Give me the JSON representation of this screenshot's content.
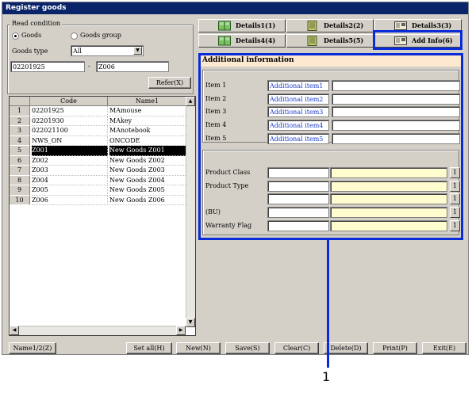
{
  "window": {
    "title": "Register goods"
  },
  "read_condition": {
    "title": "Read condition",
    "radio_goods": "Goods",
    "radio_goods_group": "Goods group",
    "goods_type_label": "Goods type",
    "goods_type_value": "All",
    "range_from": "02201925",
    "range_sep": "-",
    "range_to": "Z006",
    "refer_button": "Refer(X)"
  },
  "grid": {
    "headers": [
      "Code",
      "Name1"
    ],
    "rows": [
      {
        "n": "1",
        "code": "02201925",
        "name": "MAmouse"
      },
      {
        "n": "2",
        "code": "02201930",
        "name": "MAkey"
      },
      {
        "n": "3",
        "code": "022021100",
        "name": "MAnotebook"
      },
      {
        "n": "4",
        "code": "NWS_ON",
        "name": "ONCODE"
      },
      {
        "n": "5",
        "code": "Z001",
        "name": "New Goods Z001"
      },
      {
        "n": "6",
        "code": "Z002",
        "name": "New Goods Z002"
      },
      {
        "n": "7",
        "code": "Z003",
        "name": "New Goods Z003"
      },
      {
        "n": "8",
        "code": "Z004",
        "name": "New Goods Z004"
      },
      {
        "n": "9",
        "code": "Z005",
        "name": "New Goods Z005"
      },
      {
        "n": "10",
        "code": "Z006",
        "name": "New Goods Z006"
      }
    ],
    "selected_row": "5"
  },
  "tabs": [
    {
      "label": "Details1(1)",
      "icon": "book-icon"
    },
    {
      "label": "Details2(2)",
      "icon": "document-icon"
    },
    {
      "label": "Details3(3)",
      "icon": "card-icon"
    },
    {
      "label": "Details4(4)",
      "icon": "book-icon"
    },
    {
      "label": "Details5(5)",
      "icon": "document-icon"
    },
    {
      "label": "Add Info(6)",
      "icon": "card-icon"
    }
  ],
  "additional": {
    "header": "Additional information",
    "items": [
      {
        "label": "Item 1",
        "name": "Additional item1",
        "value": ""
      },
      {
        "label": "Item 2",
        "name": "Additional item2",
        "value": ""
      },
      {
        "label": "Item 3",
        "name": "Additional item3",
        "value": ""
      },
      {
        "label": "Item 4",
        "name": "Additional item4",
        "value": ""
      },
      {
        "label": "Item 5",
        "name": "Additional item5",
        "value": ""
      }
    ],
    "rows2": [
      {
        "label": "Product Class",
        "btn": "1"
      },
      {
        "label": "Product Type",
        "btn": "1"
      },
      {
        "label": "",
        "btn": "1"
      },
      {
        "label": "(BU)",
        "btn": "1"
      },
      {
        "label": "Warranty Flag",
        "btn": "1"
      }
    ]
  },
  "footer": {
    "name_toggle": "Name1/2(Z)",
    "set_all": "Set all(H)",
    "new": "New(N)",
    "save": "Save(S)",
    "clear": "Clear(C)",
    "delete": "Delete(D)",
    "print": "Print(P)",
    "exit": "Exit(E)"
  },
  "callout": {
    "label": "1"
  },
  "colors": {
    "highlight": "#0a2cd8",
    "title_bar": "#0a246a",
    "yellow_field": "#fffdd0",
    "blue_text": "#1a3cc8"
  }
}
